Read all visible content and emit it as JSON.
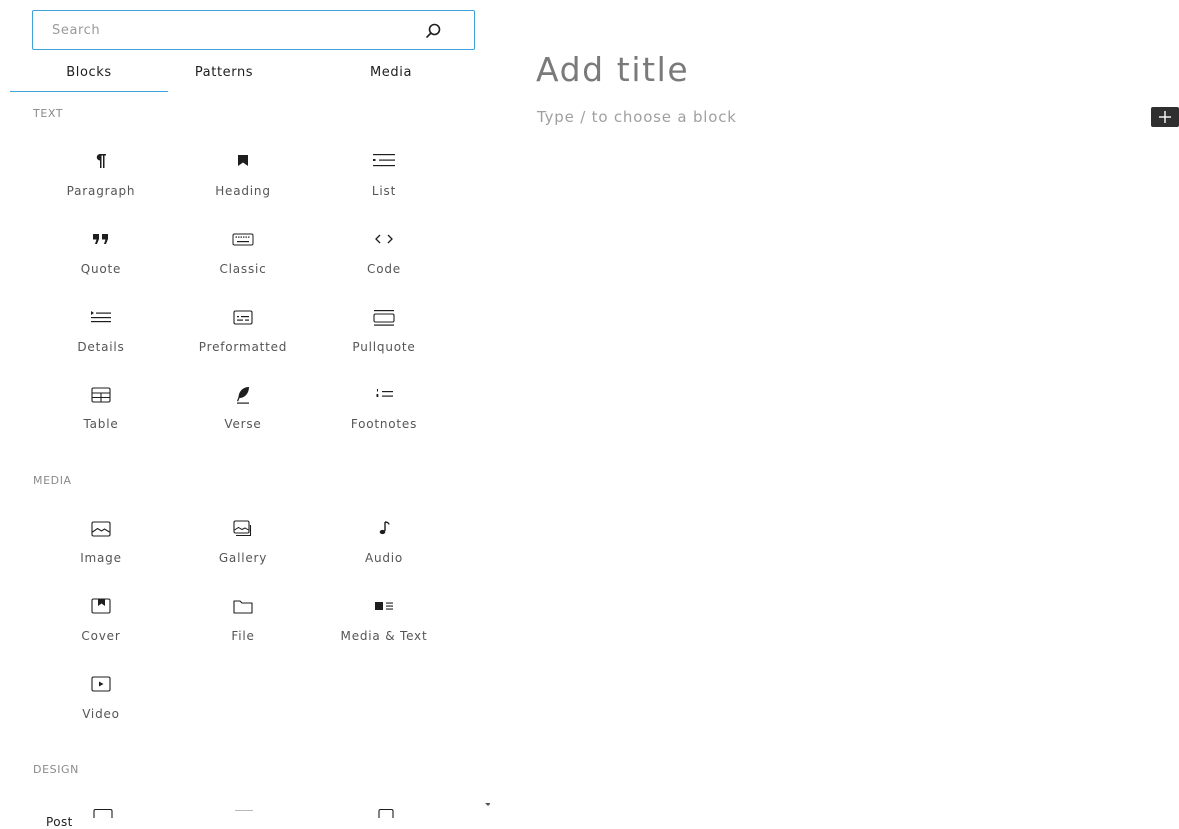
{
  "search": {
    "placeholder": "Search",
    "value": ""
  },
  "tabs": [
    {
      "label": "Blocks",
      "active": true
    },
    {
      "label": "Patterns",
      "active": false
    },
    {
      "label": "Media",
      "active": false
    }
  ],
  "categories": {
    "text": {
      "heading": "TEXT",
      "blocks": [
        {
          "label": "Paragraph",
          "icon": "paragraph-icon"
        },
        {
          "label": "Heading",
          "icon": "heading-icon"
        },
        {
          "label": "List",
          "icon": "list-icon"
        },
        {
          "label": "Quote",
          "icon": "quote-icon"
        },
        {
          "label": "Classic",
          "icon": "classic-keyboard-icon"
        },
        {
          "label": "Code",
          "icon": "code-icon"
        },
        {
          "label": "Details",
          "icon": "details-icon"
        },
        {
          "label": "Preformatted",
          "icon": "preformatted-icon"
        },
        {
          "label": "Pullquote",
          "icon": "pullquote-icon"
        },
        {
          "label": "Table",
          "icon": "table-icon"
        },
        {
          "label": "Verse",
          "icon": "verse-feather-icon"
        },
        {
          "label": "Footnotes",
          "icon": "footnotes-icon"
        }
      ]
    },
    "media": {
      "heading": "MEDIA",
      "blocks": [
        {
          "label": "Image",
          "icon": "image-icon"
        },
        {
          "label": "Gallery",
          "icon": "gallery-icon"
        },
        {
          "label": "Audio",
          "icon": "audio-note-icon"
        },
        {
          "label": "Cover",
          "icon": "cover-icon"
        },
        {
          "label": "File",
          "icon": "file-folder-icon"
        },
        {
          "label": "Media & Text",
          "icon": "media-text-icon"
        },
        {
          "label": "Video",
          "icon": "video-icon"
        }
      ]
    },
    "design": {
      "heading": "DESIGN"
    }
  },
  "footer": {
    "post_label": "Post"
  },
  "editor": {
    "title_placeholder": "Add title",
    "block_placeholder": "Type / to choose a block"
  },
  "colors": {
    "accent": "#3ea3d8",
    "toggle_bg": "#2f2f2f"
  }
}
